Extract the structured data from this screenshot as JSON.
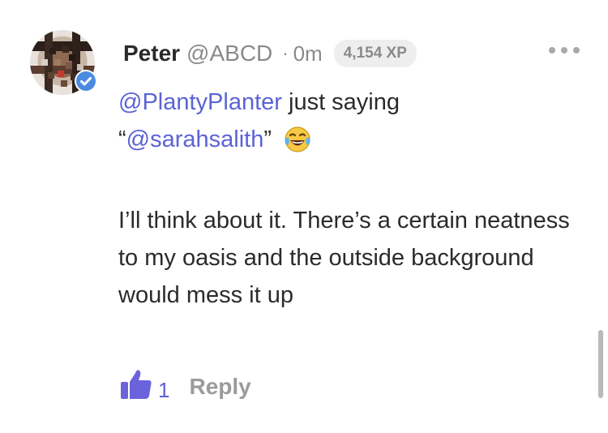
{
  "comment": {
    "author_name": "Peter",
    "author_handle": "@ABCD",
    "separator": "·",
    "time_ago": "0m",
    "xp_badge": "4,154 XP",
    "avatar_icon": "user-avatar",
    "verified_icon": "verified-badge-icon",
    "more_icon": "more-options-icon",
    "body": {
      "line1_mention": "@PlantyPlanter",
      "line1_text": " just saying",
      "line2_open_quote": "“",
      "line2_mention": "@sarahsalith",
      "line2_close_quote": "”",
      "emoji": "face-with-tears-of-joy",
      "paragraph2": "I’ll think about it. There’s a certain neatness to my oasis and the outside background would mess it up"
    },
    "like_icon": "thumbs-up-icon",
    "like_count": "1",
    "reply_label": "Reply"
  },
  "colors": {
    "accent": "#5b63d6",
    "text": "#2b2b2b",
    "muted": "#8a8a8a",
    "verified_blue": "#4a8be0",
    "badge_bg": "#eeeeee"
  }
}
